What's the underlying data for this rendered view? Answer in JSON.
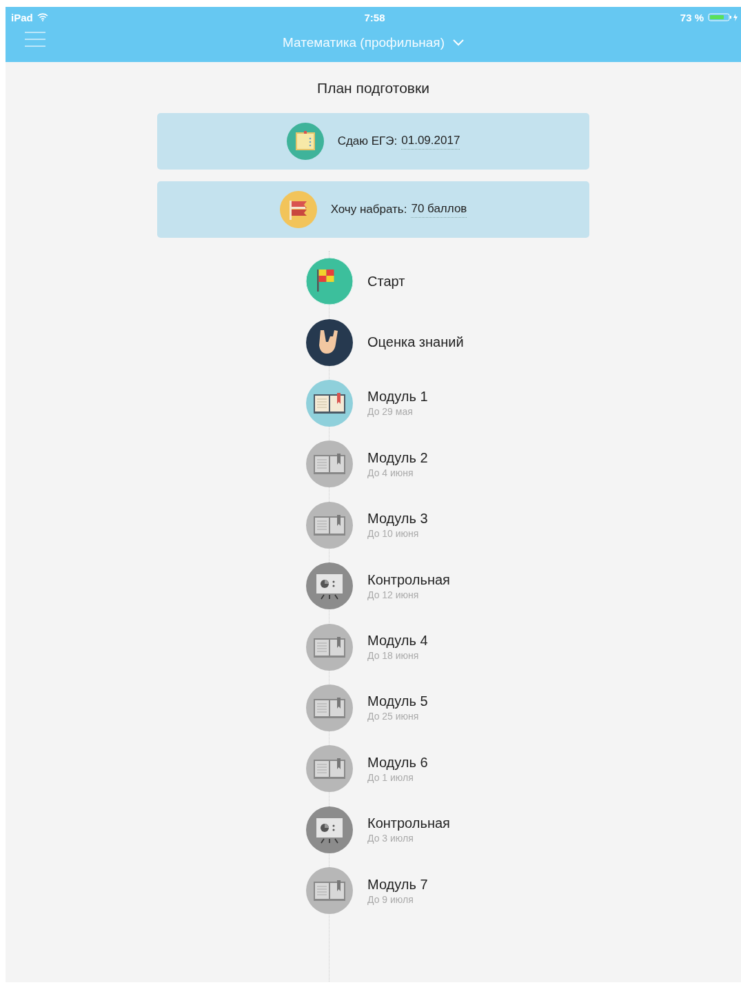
{
  "status_bar": {
    "device": "iPad",
    "time": "7:58",
    "battery": "73 %"
  },
  "nav": {
    "title": "Математика (профильная)"
  },
  "page_title": "План подготовки",
  "settings": [
    {
      "kind": "calendar",
      "label": "Сдаю ЕГЭ:",
      "value": "01.09.2017"
    },
    {
      "kind": "flag",
      "label": "Хочу набрать:",
      "value": "70 баллов"
    }
  ],
  "steps": [
    {
      "kind": "start",
      "title": "Старт",
      "disabled": false
    },
    {
      "kind": "assessment",
      "title": "Оценка знаний",
      "disabled": false
    },
    {
      "kind": "module",
      "title": "Модуль 1",
      "due": "До 29 мая",
      "disabled": false
    },
    {
      "kind": "module",
      "title": "Модуль 2",
      "due": "До 4 июня",
      "disabled": true
    },
    {
      "kind": "module",
      "title": "Модуль 3",
      "due": "До 10 июня",
      "disabled": true
    },
    {
      "kind": "test",
      "title": "Контрольная",
      "due": "До 12 июня",
      "disabled": true
    },
    {
      "kind": "module",
      "title": "Модуль 4",
      "due": "До 18 июня",
      "disabled": true
    },
    {
      "kind": "module",
      "title": "Модуль 5",
      "due": "До 25 июня",
      "disabled": true
    },
    {
      "kind": "module",
      "title": "Модуль 6",
      "due": "До 1 июля",
      "disabled": true
    },
    {
      "kind": "test",
      "title": "Контрольная",
      "due": "До 3 июля",
      "disabled": true
    },
    {
      "kind": "module",
      "title": "Модуль 7",
      "due": "До 9 июля",
      "disabled": true
    }
  ]
}
